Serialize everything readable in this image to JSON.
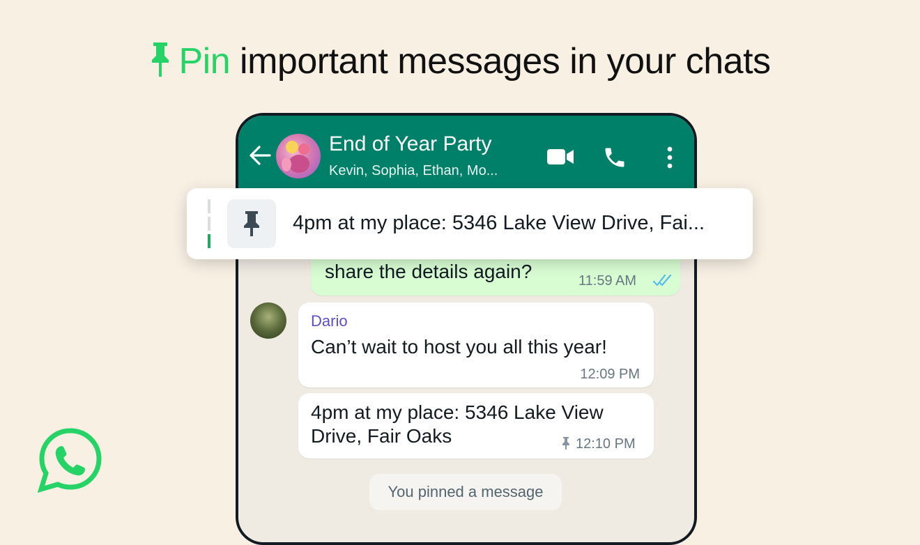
{
  "headline": {
    "accent_word": "Pin",
    "rest": " important messages in your chats",
    "accent_color": "#25d366"
  },
  "chat_header": {
    "title": "End of Year Party",
    "members": "Kevin, Sophia, Ethan, Mo...",
    "color": "#008069",
    "icons": [
      "back-arrow-icon",
      "group-avatar",
      "video-call-icon",
      "voice-call-icon",
      "more-options-icon"
    ]
  },
  "pinned_banner": {
    "text": "4pm at my place: 5346 Lake View Drive, Fai...",
    "icon": "pin-icon"
  },
  "messages": [
    {
      "direction": "outgoing",
      "text": "share the details again?",
      "time": "11:59 AM",
      "status_icon": "double-check-read-icon"
    },
    {
      "direction": "incoming",
      "sender": "Dario",
      "text": "Can’t wait to host you all this year!",
      "time": "12:09 PM"
    },
    {
      "direction": "incoming",
      "text_line1": "4pm at my place: 5346 Lake View",
      "text_line2": "Drive, Fair Oaks",
      "time": "12:10 PM",
      "pinned": true
    }
  ],
  "system_note": "You pinned a message",
  "brand": {
    "logo": "whatsapp-logo-icon",
    "color": "#25d366"
  }
}
